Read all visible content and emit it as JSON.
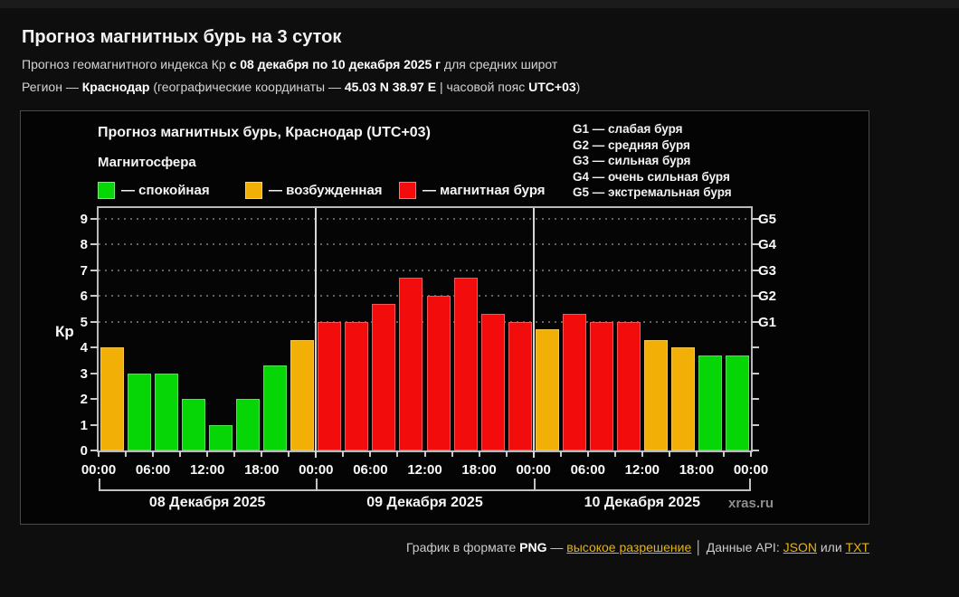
{
  "page": {
    "title": "Прогноз магнитных бурь на 3 суток",
    "subtitle_segments": [
      {
        "text": "Прогноз геомагнитного индекса Кр ",
        "style": "normal"
      },
      {
        "text": "с 08 декабря по 10 декабря 2025 г",
        "style": "bold"
      },
      {
        "text": " для средних широт",
        "style": "normal"
      }
    ],
    "region_segments": [
      {
        "text": "Регион — ",
        "style": "normal"
      },
      {
        "text": "Краснодар",
        "style": "bold"
      },
      {
        "text": " (географические координаты — ",
        "style": "normal"
      },
      {
        "text": "45.03 N 38.97 E",
        "style": "bold"
      },
      {
        "text": " | часовой пояс ",
        "style": "normal"
      },
      {
        "text": "UTC+03",
        "style": "bold"
      },
      {
        "text": ")",
        "style": "normal"
      }
    ]
  },
  "legend": {
    "title": "Магнитосфера",
    "items": [
      {
        "label": "— спокойная",
        "color": "#06d506",
        "offset": 0
      },
      {
        "label": "— возбужденная",
        "color": "#f2af05",
        "offset": 163
      },
      {
        "label": "— магнитная буря",
        "color": "#f20c0c",
        "offset": 333
      }
    ]
  },
  "g_scale_items": [
    "G1 — слабая буря",
    "G2 — средняя буря",
    "G3 — сильная буря",
    "G4 — очень сильная буря",
    "G5 — экстремальная буря"
  ],
  "watermark": "xras.ru",
  "footer": {
    "segments": [
      {
        "text": "График в формате ",
        "style": "normal"
      },
      {
        "text": "PNG",
        "style": "bold"
      },
      {
        "text": " — ",
        "style": "normal"
      },
      {
        "text": "высокое разрешение",
        "style": "link",
        "name": "high-res-link"
      },
      {
        "text": "  │  ",
        "style": "normal"
      },
      {
        "text": "Данные API: ",
        "style": "normal"
      },
      {
        "text": "JSON",
        "style": "link",
        "name": "json-api-link"
      },
      {
        "text": " или ",
        "style": "normal"
      },
      {
        "text": "TXT",
        "style": "link",
        "name": "txt-api-link"
      }
    ]
  },
  "chart_data": {
    "type": "bar",
    "title": "Прогноз магнитных бурь, Краснодар (UTC+03)",
    "ylabel": "Кр",
    "ylim": [
      0,
      9
    ],
    "yticks": [
      0,
      1,
      2,
      3,
      4,
      5,
      6,
      7,
      8,
      9
    ],
    "gridlines_at_kp": [
      5,
      6,
      7,
      8,
      9
    ],
    "grid_style": "dotted",
    "right_axis": {
      "labels": [
        "G1",
        "G2",
        "G3",
        "G4",
        "G5"
      ],
      "at_kp": [
        5,
        6,
        7,
        8,
        9
      ]
    },
    "time_tick_labels": [
      "00:00",
      "06:00",
      "12:00",
      "18:00",
      "00:00",
      "06:00",
      "12:00",
      "18:00",
      "00:00",
      "06:00",
      "12:00",
      "18:00",
      "00:00"
    ],
    "bars_per_day": 8,
    "hours_per_bar": 3,
    "days": [
      {
        "label": "08 Декабря 2025",
        "values": [
          4,
          3,
          3,
          2,
          1,
          2,
          3.3,
          4.3
        ]
      },
      {
        "label": "09 Декабря 2025",
        "values": [
          5,
          5,
          5.7,
          6.7,
          6,
          6.7,
          5.3,
          5
        ]
      },
      {
        "label": "10 Декабря 2025",
        "values": [
          4.7,
          5.3,
          5,
          5,
          4.3,
          4,
          3.7,
          3.7
        ]
      }
    ],
    "color_rules": {
      "red_from_kp": 5,
      "yellow_from_kp": 4
    },
    "palette": {
      "green": "#06d506",
      "yellow": "#f2af05",
      "red": "#f20c0c"
    }
  }
}
